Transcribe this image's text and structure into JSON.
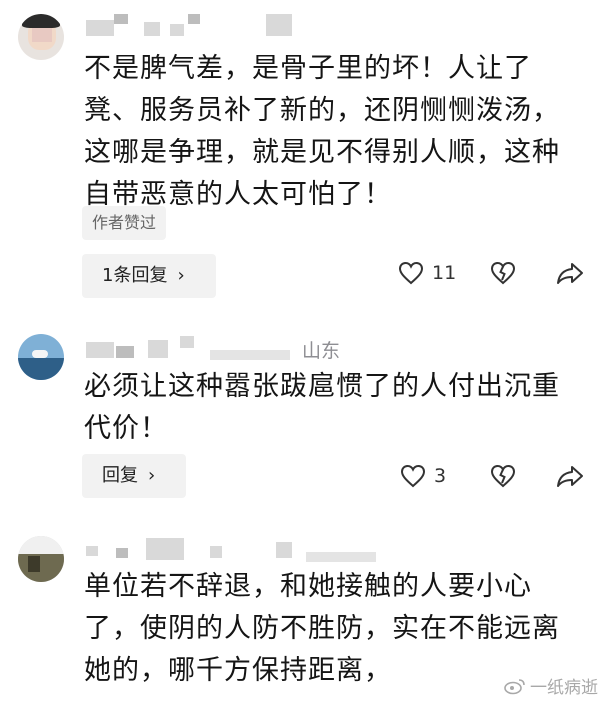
{
  "comments": [
    {
      "lines": [
        "不是脾气差，是骨子里的坏！人让了",
        "凳、服务员补了新的，还阴恻恻泼汤，",
        "这哪是争理，就是见不得别人顺，这种",
        "自带恶意的人太可怕了！"
      ],
      "author_tag": "作者赞过",
      "reply_label": "1条回复",
      "likes": "11"
    },
    {
      "location": "山东",
      "lines": [
        "必须让这种嚣张跋扈惯了的人付出沉重",
        "代价！"
      ],
      "reply_label": "回复",
      "likes": "3"
    },
    {
      "lines": [
        "单位若不辞退，和她接触的人要小心",
        "了，使阴的人防不胜防，实在不能远离",
        "她的，哪千方保持距离，"
      ]
    }
  ],
  "icons": {
    "like": "heart-outline-icon",
    "dislike": "broken-heart-icon",
    "share": "share-arrow-icon",
    "chevron": "chevron-right-icon"
  },
  "watermark": "一纸病逝"
}
